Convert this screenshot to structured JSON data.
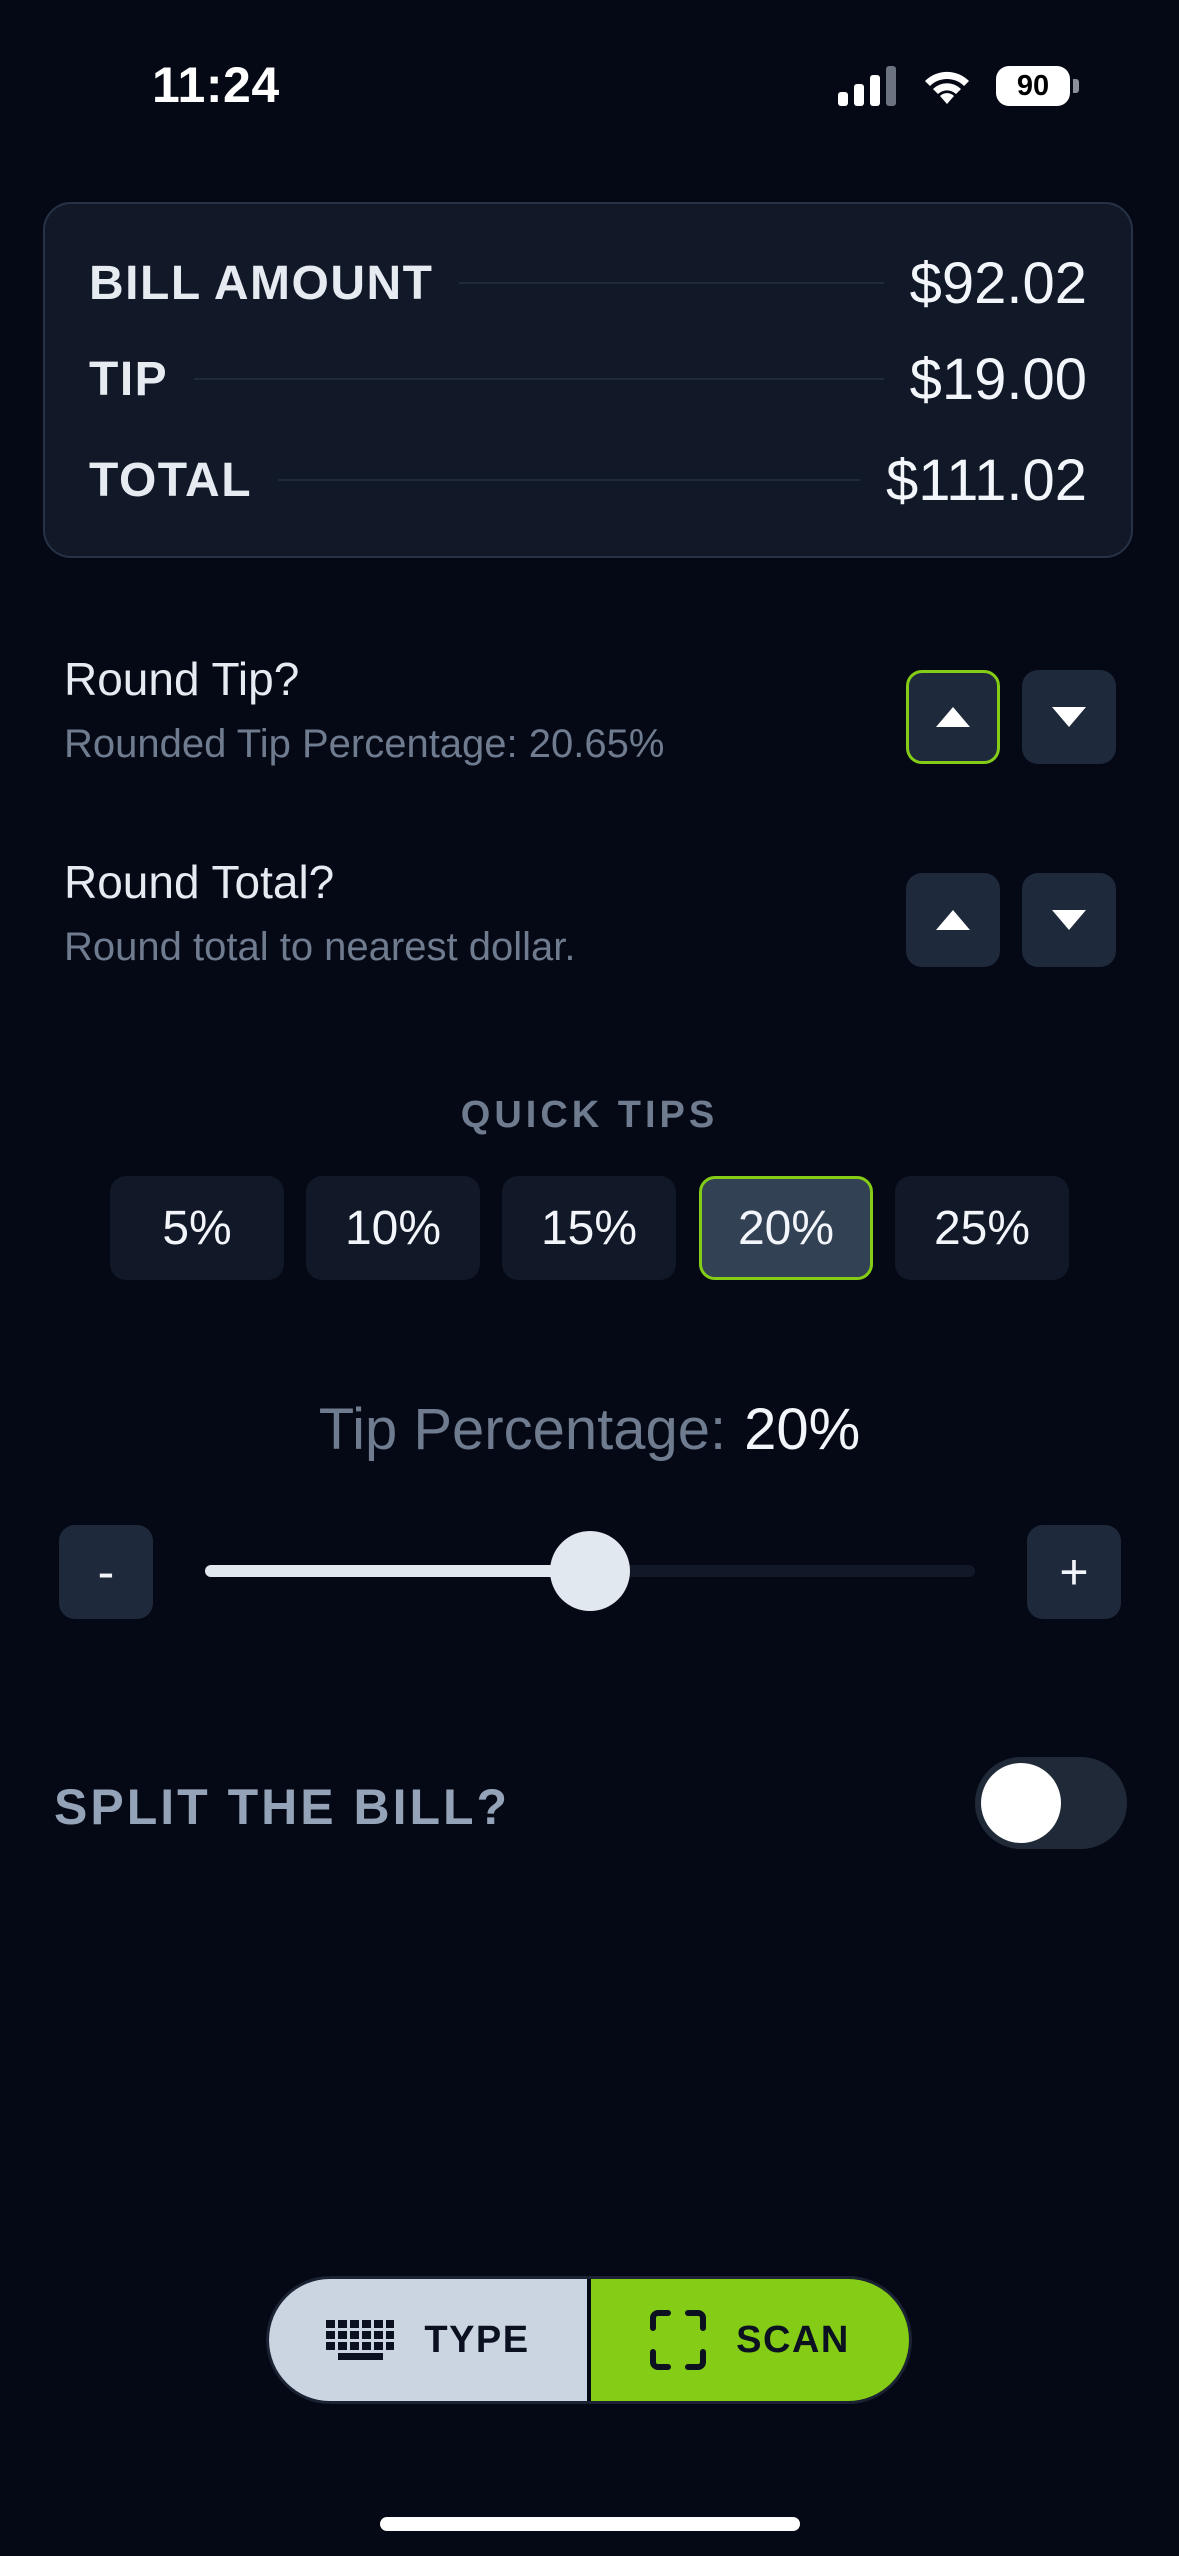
{
  "status_bar": {
    "time": "11:24",
    "battery": "90"
  },
  "summary": {
    "bill_label": "BILL AMOUNT",
    "bill_value": "$92.02",
    "tip_label": "TIP",
    "tip_value": "$19.00",
    "total_label": "TOTAL",
    "total_value": "$111.02"
  },
  "round_tip": {
    "title": "Round Tip?",
    "subtitle": "Rounded Tip Percentage: 20.65%",
    "up_active": true
  },
  "round_total": {
    "title": "Round Total?",
    "subtitle": "Round total to nearest dollar."
  },
  "quick_tips": {
    "title": "QUICK TIPS",
    "options": [
      "5%",
      "10%",
      "15%",
      "20%",
      "25%"
    ],
    "selected": "20%"
  },
  "tip_percentage": {
    "label": "Tip Percentage:",
    "value": "20%",
    "slider_fraction": 0.5,
    "minus": "-",
    "plus": "+"
  },
  "split": {
    "label": "SPLIT THE BILL?",
    "enabled": false
  },
  "bottom_bar": {
    "type_label": "TYPE",
    "scan_label": "SCAN",
    "type_icon": "keyboard-icon",
    "scan_icon": "scan-frame-icon"
  },
  "colors": {
    "accent": "#84cc16",
    "background": "#050915",
    "card": "#111827"
  }
}
